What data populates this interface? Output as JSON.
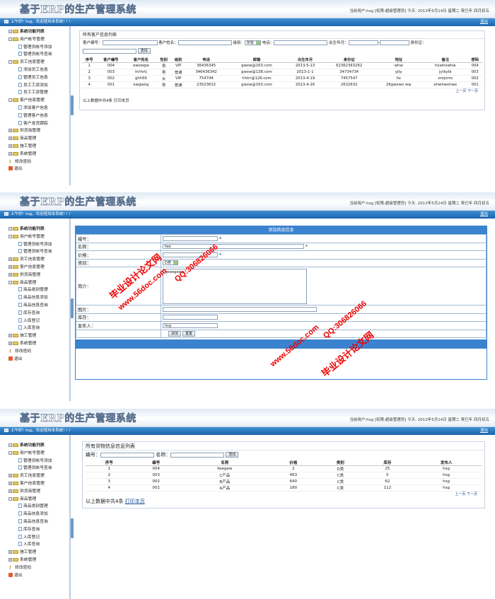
{
  "app": {
    "title": "基于ERP的生产管理系统",
    "user_info": "当前用户:hsg [权限:超级管理员] 今天: 2013年5月14日 星期二 癸巳年 四月初五",
    "greeting": "上午好! hsg，欢迎使用本系统! ! !",
    "logout": "退出"
  },
  "screen1": {
    "menu": {
      "root": "系统功能列表",
      "groups": [
        {
          "label": "用户帐号管理",
          "items": [
            "管理员帐号添加",
            "管理员帐号查询"
          ]
        },
        {
          "label": "员工信息管理",
          "items": [
            "添加员工信息",
            "管理员工信息",
            "员工工资添加",
            "员工工资管理"
          ]
        },
        {
          "label": "客户信息管理",
          "items": [
            "添加客户信息",
            "管理客户信息",
            "客户发货跟踪"
          ]
        },
        {
          "label": "供货商管理",
          "items": []
        },
        {
          "label": "商品管理",
          "items": []
        },
        {
          "label": "施工管理",
          "items": []
        },
        {
          "label": "系统管理",
          "items": []
        }
      ],
      "change_pwd": "修改密码",
      "exit": "退出"
    },
    "panel_title": "所有客户信息列表",
    "search": {
      "customer_no": "客户编号：",
      "customer_name": "客户姓名：",
      "level": "级别：",
      "level_value": "所有",
      "phone": "电话：",
      "birth": "出生年月：",
      "birth_sep": "-",
      "idcard": "身份证：",
      "button": "查找"
    },
    "table": {
      "headers": [
        "序号",
        "客户编号",
        "客户姓名",
        "性别",
        "级别",
        "电话",
        "邮箱",
        "出生年月",
        "身份证",
        "地址",
        "备注",
        "密码"
      ],
      "rows": [
        [
          "1",
          "004",
          "ewewgw",
          "男",
          "VIP",
          "36436345",
          "gwew@163.com",
          "2013-5-13",
          "62362363262",
          "whw",
          "hewhewhw",
          "004"
        ],
        [
          "2",
          "003",
          "htrhrtj",
          "男",
          "普通",
          "346436342",
          "gwew@138.com",
          "2013-1-1",
          "34734734",
          "yjty",
          "jytkytk",
          "003"
        ],
        [
          "3",
          "002",
          "ghh56",
          "女",
          "VIP",
          "754744",
          "hhtrr@126.com",
          "2013-4-19",
          "7457547",
          "he",
          "erejerre",
          "002"
        ],
        [
          "4",
          "001",
          "ewgweg",
          "男",
          "普通",
          "23523632",
          "gwew@163.com",
          "2013-4-16",
          "2632632",
          "26gwewe ww",
          "ehwhwehwe",
          "001"
        ]
      ]
    },
    "pager": {
      "prev": "上一页",
      "next": "下一页"
    },
    "footer": "以上数据中共4条",
    "print": "打印本页"
  },
  "screen2": {
    "menu": {
      "root": "系统功能列表",
      "groups": [
        {
          "label": "用户帐号管理",
          "items": [
            "管理员帐号添加",
            "管理员帐号查询"
          ]
        },
        {
          "label": "员工信息管理",
          "items": []
        },
        {
          "label": "客户信息管理",
          "items": []
        },
        {
          "label": "供货商管理",
          "items": []
        },
        {
          "label": "商品管理",
          "items": [
            "商品类别管理",
            "商品信息添加",
            "商品信息查询",
            "库存查询",
            "入库登记",
            "入库查询"
          ]
        },
        {
          "label": "施工管理",
          "items": []
        },
        {
          "label": "系统管理",
          "items": []
        }
      ],
      "change_pwd": "修改密码",
      "exit": "退出"
    },
    "form_title": "添加商品信息",
    "fields": [
      {
        "label": "编号：",
        "value": "",
        "required": "*"
      },
      {
        "label": "名称：",
        "value": "fwe",
        "required": "*"
      },
      {
        "label": "价格：",
        "value": "",
        "required": "*"
      },
      {
        "label": "类别：",
        "value": "D类"
      },
      {
        "label": "简介：",
        "value": "gewegewg"
      },
      {
        "label": "图片：",
        "value": ""
      },
      {
        "label": "库存：",
        "value": ""
      },
      {
        "label": "发布人：",
        "value": "hsg"
      }
    ],
    "add_button": "添加",
    "reset_button": "重置"
  },
  "screen3": {
    "menu": {
      "root": "系统功能列表",
      "groups": [
        {
          "label": "用户帐号管理",
          "items": [
            "管理员帐号添加",
            "管理员帐号查询"
          ]
        },
        {
          "label": "员工信息管理",
          "items": []
        },
        {
          "label": "客户信息管理",
          "items": []
        },
        {
          "label": "供货商管理",
          "items": []
        },
        {
          "label": "商品管理",
          "items": [
            "商品类别管理",
            "商品信息添加",
            "商品信息查询",
            "库存查询",
            "入库登记",
            "入库查询"
          ]
        },
        {
          "label": "施工管理",
          "items": []
        },
        {
          "label": "系统管理",
          "items": []
        }
      ],
      "change_pwd": "修改密码",
      "exit": "退出"
    },
    "panel_title": "所有货物信息信息列表",
    "search": {
      "no": "编号：",
      "name": "名称：",
      "button": "查找"
    },
    "table": {
      "headers": [
        "序号",
        "编号",
        "名称",
        "价格",
        "类别",
        "库存",
        "发布人"
      ],
      "rows": [
        [
          "1",
          "004",
          "fwegew",
          "2",
          "D类",
          "25",
          "hsg"
        ],
        [
          "2",
          "003",
          "C产品",
          "463",
          "C类",
          "5",
          "hsg"
        ],
        [
          "3",
          "002",
          "B产品",
          "640",
          "C类",
          "62",
          "hsg"
        ],
        [
          "4",
          "001",
          "A产品",
          "180",
          "C类",
          "112",
          "hsg"
        ]
      ]
    },
    "pager": {
      "prev": "上一页",
      "next": "下一页"
    },
    "footer": "以上数据中共4条",
    "print": "打印本页"
  },
  "watermark": {
    "site": "毕业设计论文网",
    "url": "www.56doc.com",
    "qq": "QQ:306826066"
  }
}
